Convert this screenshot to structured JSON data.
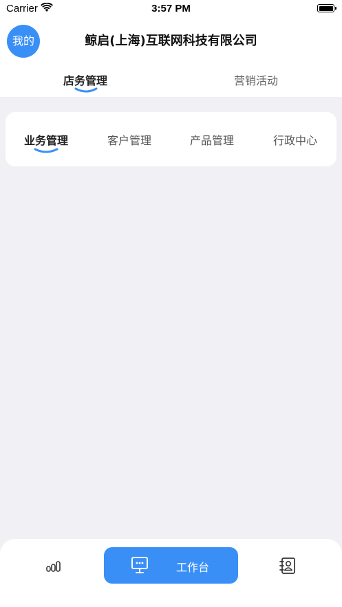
{
  "status_bar": {
    "carrier": "Carrier",
    "time": "3:57 PM"
  },
  "header": {
    "avatar_label": "我的",
    "company_name": "鲸启(上海)互联网科技有限公司"
  },
  "top_tabs": [
    {
      "label": "店务管理",
      "active": true
    },
    {
      "label": "营销活动",
      "active": false
    }
  ],
  "sub_tabs": [
    {
      "label": "业务管理",
      "active": true
    },
    {
      "label": "客户管理",
      "active": false
    },
    {
      "label": "产品管理",
      "active": false
    },
    {
      "label": "行政中心",
      "active": false
    }
  ],
  "bottom_nav": {
    "stats_icon": "bar-chart-icon",
    "workbench_label": "工作台",
    "workbench_icon": "monitor-icon",
    "contacts_icon": "contact-book-icon"
  },
  "colors": {
    "accent": "#3a8ff7",
    "background": "#f0f0f5"
  }
}
